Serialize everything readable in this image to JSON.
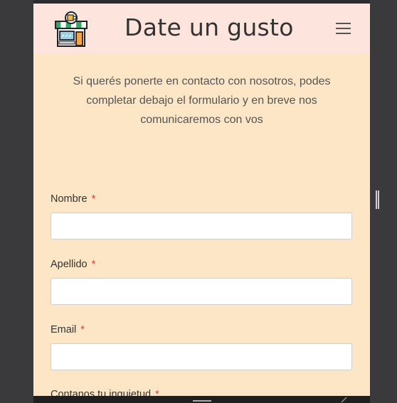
{
  "header": {
    "title": "Date un gusto",
    "logo_icon": "coffee-shop-icon",
    "menu_icon": "hamburger-menu-icon"
  },
  "intro_text": "Si querés ponerte en contacto con nosotros, podes completar debajo el formulario y en breve nos comunicaremos con vos",
  "form": {
    "required_marker": "*",
    "fields": [
      {
        "label": "Nombre",
        "value": ""
      },
      {
        "label": "Apellido",
        "value": ""
      },
      {
        "label": "Email",
        "value": ""
      },
      {
        "label": "Contanos tu inquietud",
        "value": ""
      }
    ]
  },
  "colors": {
    "header_bg": "#fde4dc",
    "page_bg": "#fce6c6",
    "required": "#e03a3a"
  }
}
